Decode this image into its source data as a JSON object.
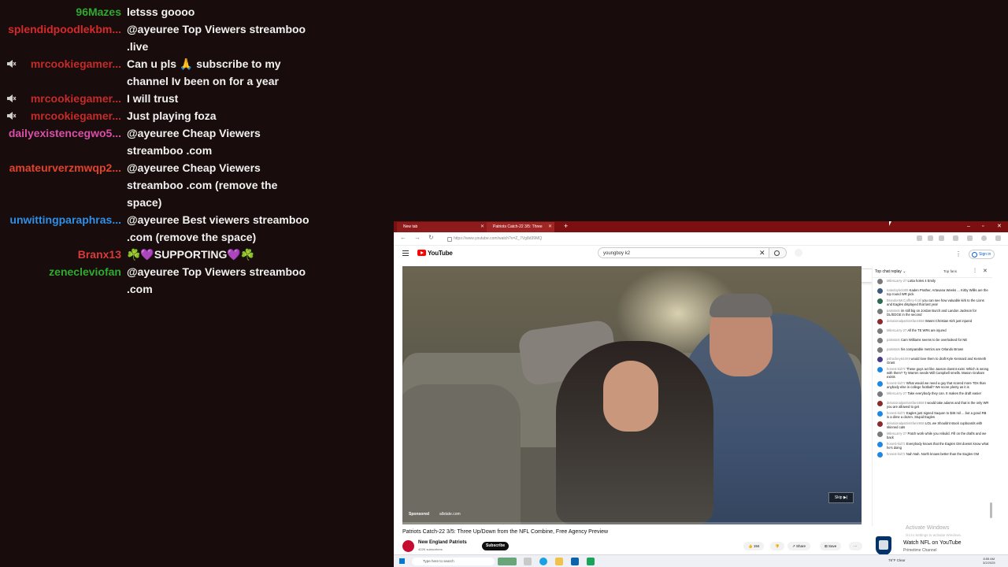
{
  "chat_overlay": {
    "messages": [
      {
        "user": "96Mazes",
        "color": "#2eab2e",
        "muted": false,
        "text": "letsss goooo"
      },
      {
        "user": "splendidpoodlekbm...",
        "color": "#d62a2a",
        "muted": false,
        "text": "@ayeuree Top Viewers streamboo .live"
      },
      {
        "user": "mrcookiegamer...",
        "color": "#c42b2b",
        "muted": true,
        "text": "Can u pls 🙏 subscribe to my channel Iv been on for a year"
      },
      {
        "user": "mrcookiegamer...",
        "color": "#c42b2b",
        "muted": true,
        "text": "I will trust"
      },
      {
        "user": "mrcookiegamer...",
        "color": "#c42b2b",
        "muted": true,
        "text": "Just playing foza"
      },
      {
        "user": "dailyexistencegwo5...",
        "color": "#d94fa8",
        "muted": false,
        "text": "@ayeuree Cheap Viewers streamboo .com"
      },
      {
        "user": "amateurverzmwqp2...",
        "color": "#e0432d",
        "muted": false,
        "text": "@ayeuree Cheap Viewers streamboo .com (remove the space)"
      },
      {
        "user": "unwittingparaphras...",
        "color": "#2f8fe6",
        "muted": false,
        "text": "@ayeuree Best viewers streamboo .com (remove the space)"
      },
      {
        "user": "Branx13",
        "color": "#d63b3b",
        "muted": false,
        "text": "☘️💜SUPPORTING💜☘️"
      },
      {
        "user": "zenecleviofan",
        "color": "#2eab2e",
        "muted": false,
        "text": "@ayeuree Top Viewers streamboo .com"
      }
    ]
  },
  "browser": {
    "tabs": [
      {
        "label": "New tab"
      },
      {
        "label": "Patriots Catch-22 3/5: Three"
      }
    ],
    "url": "https://www.youtube.com/watch?v=Z_7Vg8d39MQ",
    "youtube": {
      "logo_text": "YouTube",
      "search_value": "youngboy k2",
      "sign_in": "Sign in"
    },
    "video": {
      "sponsored": "Sponsored",
      "sponsor_url": "allstate.com",
      "skip_label": "Skip ▶|",
      "progress": 0.0,
      "title": "Patriots Catch-22 3/5: Three Up/Down from the NFL Combine, Free Agency Preview",
      "channel_name": "New England Patriots",
      "channel_subs": "422K subscribers",
      "subscribe_label": "Subscribe",
      "likes": "194",
      "share_label": "Share",
      "save_label": "Save"
    },
    "live_chat": {
      "title": "Top chat replay ⌄",
      "top_talk": "Top fans",
      "messages": [
        {
          "author": "MilesLarry-27",
          "text": "Lotta holes 4 Emily",
          "color": "#7a7a7a"
        },
        {
          "author": "natedoyle3409",
          "text": "Kaden Prather, Artavana Weeks ... Kirby Willis are the top round WR pick",
          "color": "#3d5a80"
        },
        {
          "author": "BrandonMcCaffrey-fo3il",
          "text": "you can see how valuable kirk to the Lions and Eagles displayed that last year",
          "color": "#2d6a4f"
        },
        {
          "author": "patsstats",
          "text": "im still big on Jordan Burch and Landon Jackson for DL/EDGE in the second",
          "color": "#7a7a7a"
        },
        {
          "author": "delusionalpatriotsfan4658",
          "text": "Wasnt Christian Kirk just injured",
          "color": "#8a2b2b"
        },
        {
          "author": "MilesLarry-27",
          "text": "All the TE WRs are injured",
          "color": "#7a7a7a"
        },
        {
          "author": "patsstats",
          "text": "Cam Williams seems to be overlooked for NE",
          "color": "#7a7a7a"
        },
        {
          "author": "patsstats",
          "text": "his comparable metrics are Orlando Brown",
          "color": "#7a7a7a"
        },
        {
          "author": "pshockey6449",
          "text": "I would love them to draft Kyle Kennard and Kenneth Grant",
          "color": "#4a3b8a"
        },
        {
          "author": "honest-kid7z",
          "text": "These guys act like Jaxson doesnt exist. Which is wrong with them? Ty Warren needs Will Campbell smells. Mason Graham exists",
          "color": "#1e88e5"
        },
        {
          "author": "honest-kid7z",
          "text": "What would we need a guy that scored more TDs than anybody else in college football? We score plenty as it is",
          "color": "#1e88e5"
        },
        {
          "author": "MilesLarry-27",
          "text": "Take everybody they can. It makes the draft easier",
          "color": "#7a7a7a"
        },
        {
          "author": "delusionalpatriotsfan4658",
          "text": "I would take adams and that is the only WR you are allowed to get",
          "color": "#8a2b2b"
        },
        {
          "author": "honest-kid7z",
          "text": "Eagles just signed Saquon to $46 mil ... but a good RB is a dime a dozen. Stupid Eagles",
          "color": "#1e88e5"
        },
        {
          "author": "delusionalpatriotsfan4658",
          "text": "LOL we Shouldnt stack cupboards with skinned cats",
          "color": "#8a2b2b"
        },
        {
          "author": "MilesLarry-27",
          "text": "Patch work while you rebuild. Fill on the drafts and we back",
          "color": "#7a7a7a"
        },
        {
          "author": "honest-kid7z",
          "text": "Everybody knows that the Eagles GM doesnt know what he's doing",
          "color": "#1e88e5"
        },
        {
          "author": "honest-kid7z",
          "text": "Nah Nah. North knows better than the Eagles GM",
          "color": "#1e88e5"
        }
      ]
    },
    "promo": {
      "title": "Watch NFL on YouTube",
      "subtitle": "Primetime Channel",
      "activate_title": "Activate Windows",
      "activate_sub": "Go to Settings to activate Windows."
    },
    "taskbar": {
      "search_placeholder": "Type here to search",
      "weather": "79°F Clear",
      "time": "8:55 AM",
      "date": "3/2/2025"
    }
  }
}
